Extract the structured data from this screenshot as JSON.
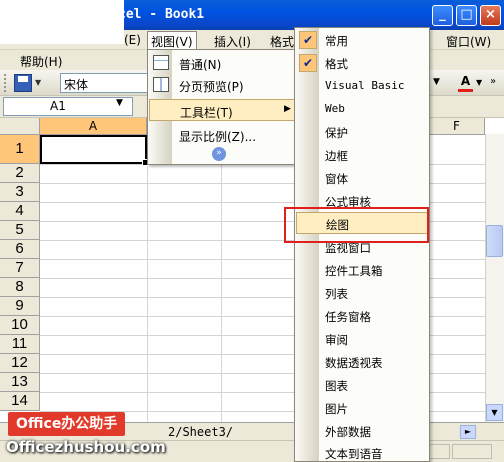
{
  "window": {
    "title": "cel - Book1",
    "buttons": [
      "_",
      "□",
      "×"
    ]
  },
  "menubar": {
    "items": [
      {
        "label": "(E)"
      },
      {
        "label": "视图(V)"
      },
      {
        "label": "插入(I)"
      },
      {
        "label": "格式"
      },
      {
        "label": "窗口(W)"
      }
    ],
    "help_label": "帮助(H)"
  },
  "toolbar": {
    "font_name": "宋体",
    "font_color_glyph": "A"
  },
  "formula_bar": {
    "name_box": "A1"
  },
  "sheet": {
    "columns": [
      {
        "label": "A",
        "active": true
      },
      {
        "label": ""
      },
      {
        "label": ""
      },
      {
        "label": ""
      },
      {
        "label": ""
      },
      {
        "label": "F"
      }
    ],
    "rows": [
      "1",
      "2",
      "3",
      "4",
      "5",
      "6",
      "7",
      "8",
      "9",
      "10",
      "11",
      "12",
      "13",
      "14"
    ],
    "tabs_text": "2/Sheet3/"
  },
  "view_menu": {
    "items": [
      {
        "label": "普通(N)",
        "icon": "normal-view-icon"
      },
      {
        "label": "分页预览(P)",
        "icon": "page-break-preview-icon"
      },
      {
        "label": "工具栏(T)",
        "submenu": true,
        "highlighted": true
      },
      {
        "label": "显示比例(Z)..."
      }
    ],
    "expand_glyph": "»"
  },
  "toolbars_submenu": {
    "items": [
      {
        "label": "常用",
        "checked": true
      },
      {
        "label": "格式",
        "checked": true
      },
      {
        "label": "Visual Basic"
      },
      {
        "label": "Web"
      },
      {
        "label": "保护"
      },
      {
        "label": "边框"
      },
      {
        "label": "窗体"
      },
      {
        "label": "公式审核"
      },
      {
        "label": "绘图",
        "highlighted": true
      },
      {
        "label": "监视窗口"
      },
      {
        "label": "控件工具箱"
      },
      {
        "label": "列表"
      },
      {
        "label": "任务窗格"
      },
      {
        "label": "审阅"
      },
      {
        "label": "数据透视表"
      },
      {
        "label": "图表"
      },
      {
        "label": "图片"
      },
      {
        "label": "外部数据"
      },
      {
        "label": "文本到语音"
      }
    ]
  },
  "watermark": {
    "badge": "Office办公助手",
    "url": "Officezhushou.com"
  },
  "colors": {
    "title_bar": "#0A5FD8",
    "highlight": "#FFEEC2",
    "active_header": "#FFC67A",
    "annotation_red": "#E0201C",
    "watermark_red": "#E23A2A"
  }
}
